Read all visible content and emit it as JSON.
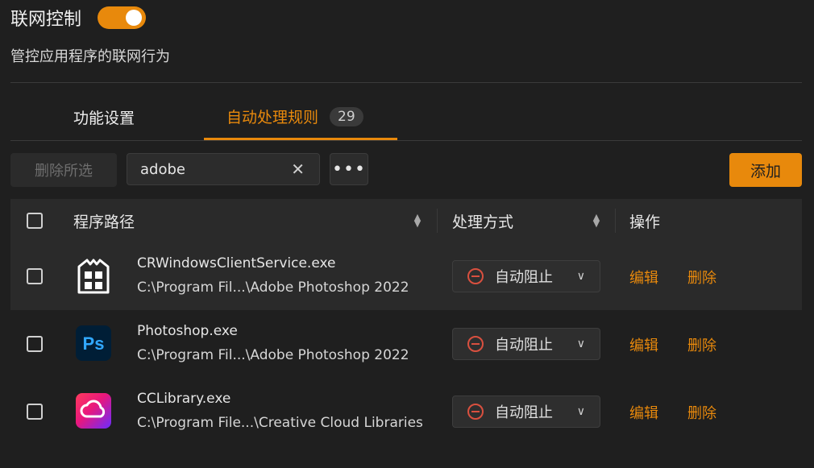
{
  "header": {
    "title": "联网控制",
    "subtitle": "管控应用程序的联网行为",
    "toggle_on": true
  },
  "tabs": [
    {
      "label": "功能设置"
    },
    {
      "label": "自动处理规则",
      "count": "29"
    }
  ],
  "toolbar": {
    "delete_selected": "删除所选",
    "search_value": "adobe",
    "clear_glyph": "✕",
    "more_glyph": "•••",
    "add_label": "添加"
  },
  "table": {
    "columns": [
      "程序路径",
      "处理方式",
      "操作"
    ],
    "rows": [
      {
        "name": "CRWindowsClientService.exe",
        "path": "C:\\Program Fil...\\Adobe Photoshop 2022",
        "mode": "自动阻止",
        "edit": "编辑",
        "delete": "删除",
        "icon": "generic-app-icon"
      },
      {
        "name": "Photoshop.exe",
        "path": "C:\\Program Fil...\\Adobe Photoshop 2022",
        "mode": "自动阻止",
        "edit": "编辑",
        "delete": "删除",
        "icon": "photoshop-icon",
        "icon_text": "Ps"
      },
      {
        "name": "CCLibrary.exe",
        "path": "C:\\Program File...\\Creative Cloud Libraries",
        "mode": "自动阻止",
        "edit": "编辑",
        "delete": "删除",
        "icon": "creative-cloud-icon"
      }
    ]
  },
  "colors": {
    "accent": "#e8890c",
    "block": "#d9503f",
    "background": "#1f1f1f"
  }
}
